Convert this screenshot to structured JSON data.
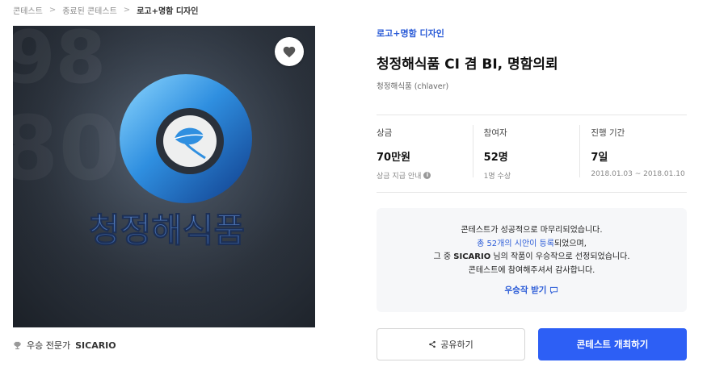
{
  "breadcrumb": {
    "items": [
      "콘테스트",
      "종료된 콘테스트",
      "로고+명함 디자인"
    ],
    "separator": ">"
  },
  "hero": {
    "logo_text": "청정해식품",
    "favorite_icon": "heart-icon"
  },
  "winner": {
    "icon": "trophy-icon",
    "label": "우승 전문가",
    "name": "SICARIO"
  },
  "contest": {
    "category": "로고+명함 디자인",
    "title": "청정해식품 CI 겸 BI, 명함의뢰",
    "owner": "청정해식품 (chlaver)"
  },
  "stats": [
    {
      "label": "상금",
      "value": "70만원",
      "sub": "상금 지급 안내",
      "has_info": true
    },
    {
      "label": "참여자",
      "value": "52명",
      "sub": "1명 수상",
      "has_info": false
    },
    {
      "label": "진행 기간",
      "value": "7일",
      "sub": "2018.01.03 ~ 2018.01.10",
      "has_info": false
    }
  ],
  "notice": {
    "line1": "콘테스트가 성공적으로 마무리되었습니다.",
    "line2_link": "총 52개의 시안이 등록",
    "line2_rest": "되었으며,",
    "line3_pre": "그 중 ",
    "line3_name": "SICARIO",
    "line3_rest": " 님의 작품이 우승작으로 선정되었습니다.",
    "line4": "콘테스트에 참여해주셔서 감사합니다.",
    "receive_label": "우승작 받기",
    "receive_icon": "chat-icon"
  },
  "actions": {
    "share_label": "공유하기",
    "share_icon": "share-icon",
    "host_label": "콘테스트 개최하기"
  },
  "colors": {
    "accent": "#2d5ff5",
    "link": "#2a5bd7",
    "notice_bg": "#f6f7f9"
  }
}
